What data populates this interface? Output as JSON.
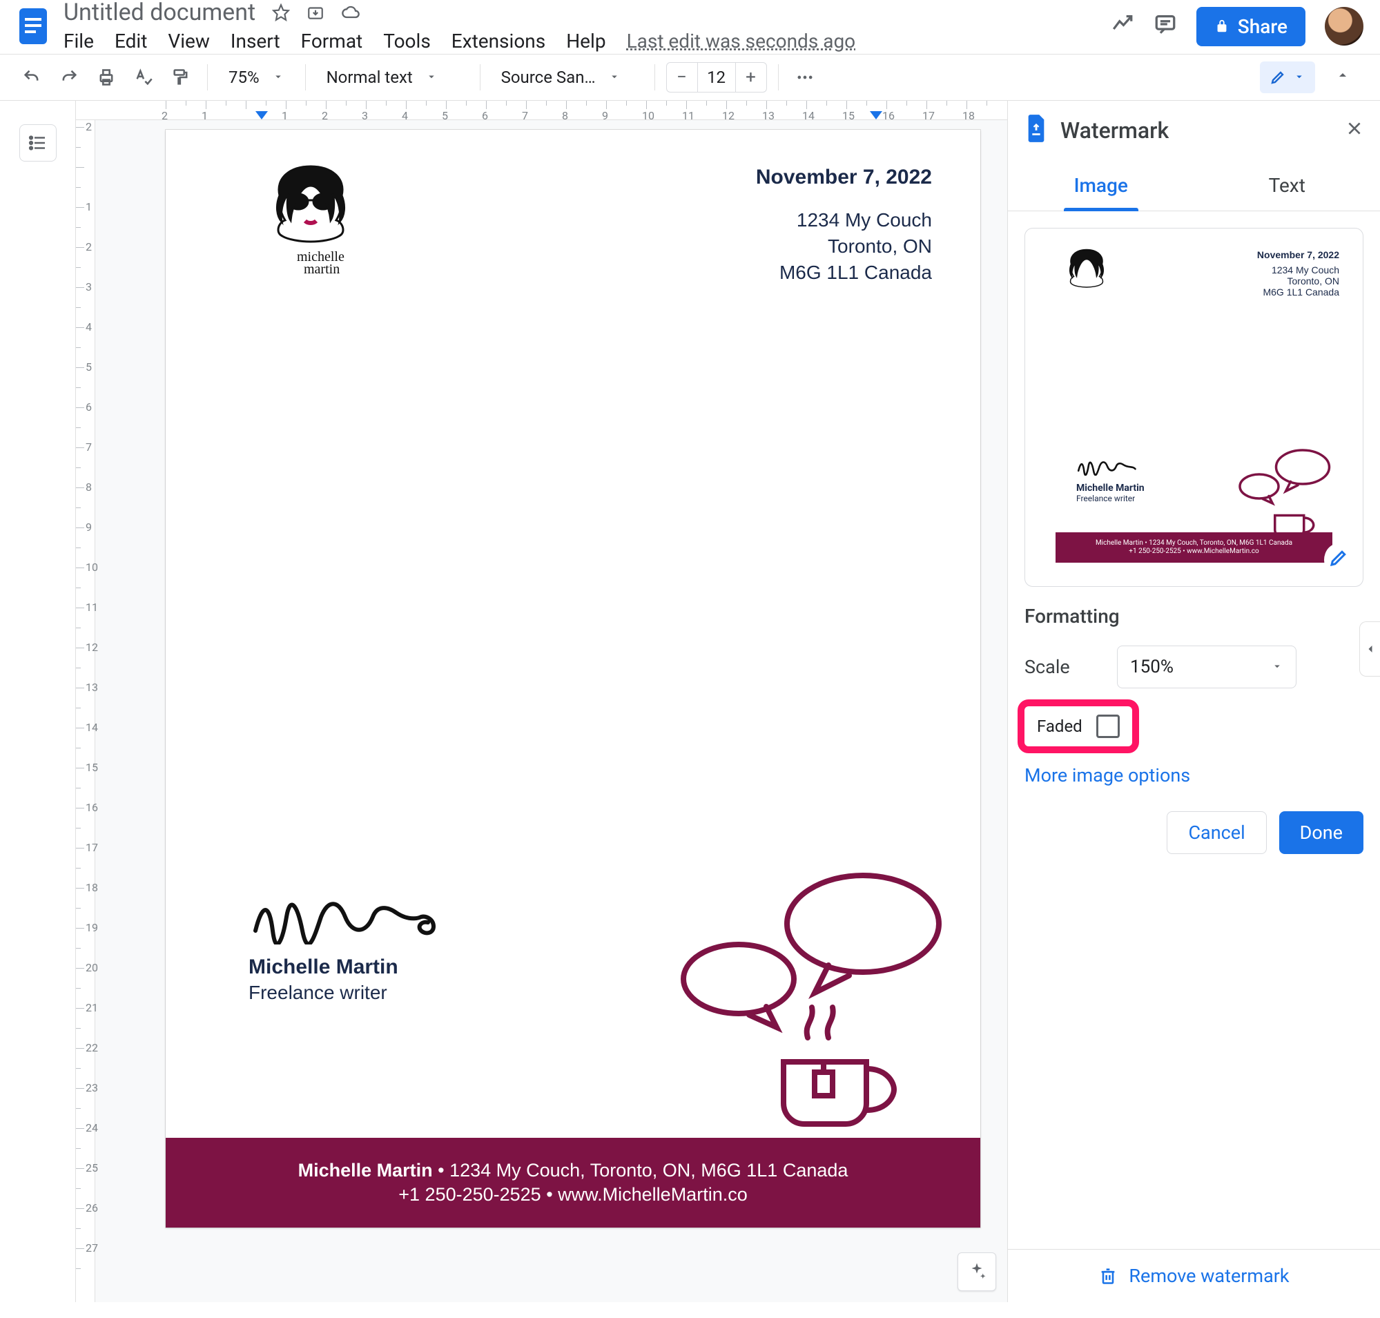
{
  "chrome": {
    "doc_title": "Untitled document",
    "last_edit": "Last edit was seconds ago",
    "share_label": "Share"
  },
  "menubar": [
    "File",
    "Edit",
    "View",
    "Insert",
    "Format",
    "Tools",
    "Extensions",
    "Help"
  ],
  "toolbar": {
    "zoom": "75%",
    "style": "Normal text",
    "font": "Source San…",
    "font_size": "12"
  },
  "ruler_h": [
    "2",
    "1",
    "",
    "1",
    "2",
    "3",
    "4",
    "5",
    "6",
    "7",
    "8",
    "9",
    "10",
    "11",
    "12",
    "13",
    "14",
    "15",
    "16",
    "17",
    "18"
  ],
  "ruler_v": [
    "2",
    "",
    "1",
    "2",
    "3",
    "4",
    "5",
    "6",
    "7",
    "8",
    "9",
    "10",
    "11",
    "12",
    "13",
    "14",
    "15",
    "16",
    "17",
    "18",
    "19",
    "20",
    "21",
    "22",
    "23",
    "24",
    "25",
    "26",
    "27"
  ],
  "doc": {
    "date": "November 7, 2022",
    "addr1": "1234 My Couch",
    "addr2": "Toronto, ON",
    "addr3": "M6G 1L1  Canada",
    "logo_wordmark1": "michelle",
    "logo_wordmark2": "martin",
    "sig_name": "Michelle Martin",
    "sig_role": "Freelance writer",
    "footer_l1_strong": "Michelle Martin",
    "footer_l1_rest": " • 1234 My Couch, Toronto, ON, M6G 1L1 Canada",
    "footer_l2": "+1 250-250-2525 • www.MichelleMartin.co"
  },
  "panel": {
    "title": "Watermark",
    "tab_image": "Image",
    "tab_text": "Text",
    "formatting_label": "Formatting",
    "scale_label": "Scale",
    "scale_value": "150%",
    "faded_label": "Faded",
    "more_options": "More image options",
    "cancel": "Cancel",
    "done": "Done",
    "remove": "Remove watermark",
    "preview": {
      "date": "November 7, 2022",
      "addr1": "1234 My Couch",
      "addr2": "Toronto, ON",
      "addr3": "M6G 1L1  Canada",
      "name": "Michelle Martin",
      "role": "Freelance writer",
      "foot1": "Michelle Martin • 1234 My Couch, Toronto, ON, M6G 1L1 Canada",
      "foot2": "+1 250-250-2525 • www.MichelleMartin.co"
    }
  }
}
